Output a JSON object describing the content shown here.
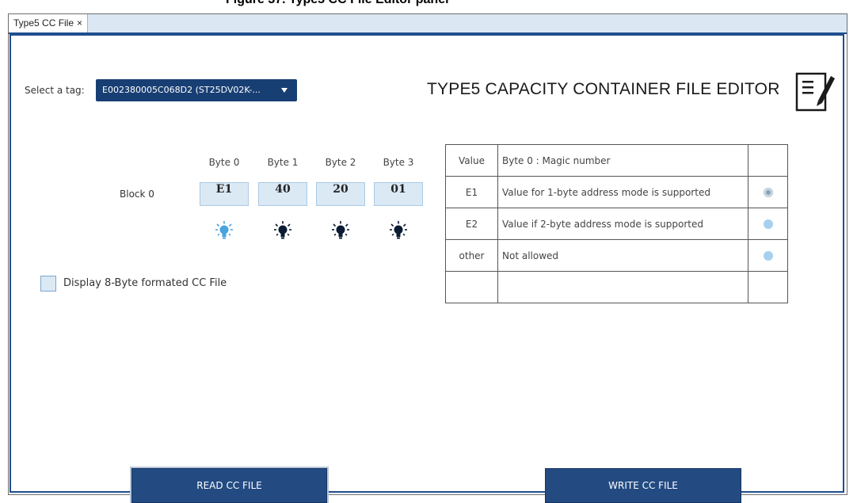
{
  "top_caption": "Figure 37. Type5 CC File Editor panel",
  "tab": {
    "label": "Type5 CC File",
    "close": "×"
  },
  "tag_select": {
    "label": "Select a tag:",
    "value": "E002380005C068D2 (ST25DV02K-..."
  },
  "title": "TYPE5 CAPACITY CONTAINER FILE EDITOR",
  "block": {
    "label": "Block 0",
    "byte_headers": [
      "Byte 0",
      "Byte 1",
      "Byte 2",
      "Byte 3"
    ],
    "values": [
      "E1",
      "40",
      "20",
      "01"
    ],
    "bulb_colors": [
      "#4aa3df",
      "#0b1b33",
      "#0b1b33",
      "#0b1b33"
    ]
  },
  "checkbox": {
    "label": "Display 8-Byte formated CC File",
    "checked": false
  },
  "table": {
    "rows": [
      {
        "value": "Value",
        "desc": "Byte 0 : Magic number",
        "radio": null
      },
      {
        "value": "E1",
        "desc": "Value for 1-byte address mode is supported",
        "radio": "selected"
      },
      {
        "value": "E2",
        "desc": "Value if 2-byte address mode is supported",
        "radio": "unselected"
      },
      {
        "value": "other",
        "desc": "Not allowed",
        "radio": "unselected"
      },
      {
        "value": "",
        "desc": "",
        "radio": null
      }
    ]
  },
  "buttons": {
    "read": "READ CC FILE",
    "write": "WRITE CC FILE"
  }
}
